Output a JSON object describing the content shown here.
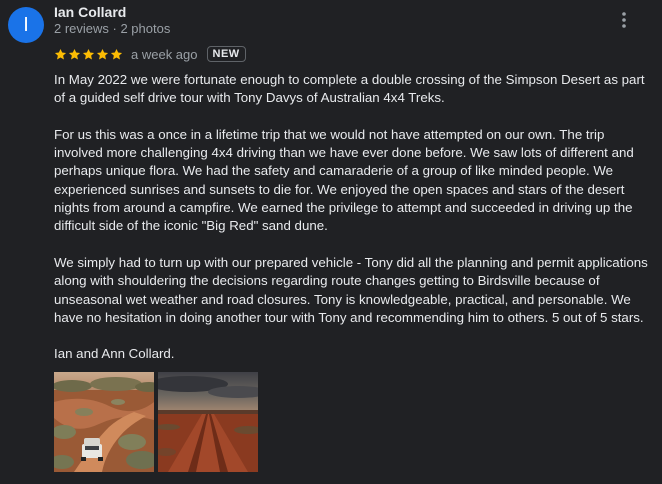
{
  "reviewer": {
    "initial": "I",
    "name": "Ian Collard",
    "meta": "2 reviews · 2 photos"
  },
  "rating": {
    "stars": 5,
    "max": 5,
    "date": "a week ago",
    "badge": "NEW"
  },
  "review": {
    "paragraphs": [
      "In May 2022 we were fortunate enough to complete a double crossing of the Simpson Desert as part of a guided self drive tour with Tony Davys of Australian 4x4 Treks.",
      "For us this was a once in a lifetime trip that we would not have attempted on our own. The trip involved more challenging 4x4 driving than we have ever done before. We saw lots of different and perhaps unique flora. We had the safety and camaraderie  of a group of like minded people. We experienced sunrises and sunsets to die for. We enjoyed the open spaces and stars of the desert nights from around a campfire. We earned the privilege to attempt and succeeded in driving up the difficult side of the iconic \"Big Red\" sand dune.",
      "We simply had to turn up with our prepared vehicle - Tony did all the planning and permit applications along with shouldering the decisions regarding route changes getting to Birdsville because of unseasonal wet weather and road closures. Tony is knowledgeable, practical, and personable. We have no hesitation in doing another tour with Tony and recommending him to others. 5 out of 5 stars.",
      "Ian and Ann Collard."
    ]
  },
  "photos": [
    {
      "icon": "desert-4wd-photo"
    },
    {
      "icon": "desert-road-sunset-photo"
    }
  ],
  "colors": {
    "background": "#202124",
    "avatar": "#1a73e8",
    "star": "#fbbc04",
    "text": "#e8eaed",
    "muted": "#9aa0a6"
  },
  "icons": {
    "more": "more-vert-icon",
    "star": "star-icon"
  }
}
